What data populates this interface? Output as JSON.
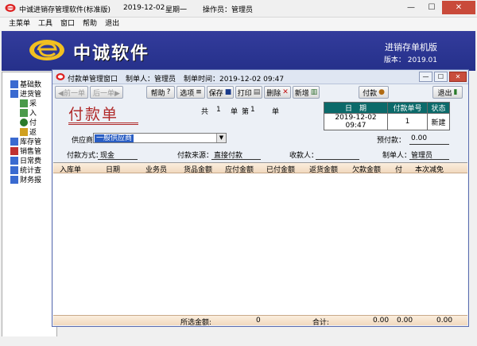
{
  "window": {
    "title": "中诚进销存管理软件(标准版)",
    "date": "2019-12-02",
    "weekday": "星期一",
    "operator": "操作员：管理员",
    "min": "—",
    "max": "☐",
    "close": "✕"
  },
  "menu": [
    "主菜单",
    "工具",
    "窗口",
    "帮助",
    "退出"
  ],
  "banner": {
    "brand": "中诚软件",
    "edition": "进销存单机版",
    "version": "版本：  2019.01"
  },
  "nav": [
    {
      "label": "基础数",
      "icon": "book-icon",
      "color": "#3a6ad0"
    },
    {
      "label": "进货管",
      "icon": "cart-icon",
      "color": "#3a6ad0"
    },
    {
      "label": "采",
      "icon": "doc-icon",
      "color": "#4a9a4a"
    },
    {
      "label": "入",
      "icon": "doc-icon",
      "color": "#4a9a4a"
    },
    {
      "label": "付",
      "icon": "coin-icon",
      "color": "#2a7a2a"
    },
    {
      "label": "返",
      "icon": "folder-icon",
      "color": "#d0a020"
    },
    {
      "label": "库存管",
      "icon": "warehouse-icon",
      "color": "#3a6ad0"
    },
    {
      "label": "销售管",
      "icon": "sales-icon",
      "color": "#c03030"
    },
    {
      "label": "日常费",
      "icon": "calendar-icon",
      "color": "#3a6ad0"
    },
    {
      "label": "统计查",
      "icon": "stats-icon",
      "color": "#3a6ad0"
    },
    {
      "label": "财务报",
      "icon": "finance-icon",
      "color": "#3a6ad0"
    }
  ],
  "child": {
    "title": "付款单管理窗口",
    "maker": "制单人：管理员",
    "make_time": "制单时间：2019-12-02 09:47"
  },
  "toolbar": {
    "prev": "◀前一单",
    "next": "后一单▶",
    "help": "帮助",
    "options": "选项",
    "save": "保存",
    "print": "打印",
    "delete": "删除",
    "add": "新增",
    "pay": "付款",
    "exit": "退出"
  },
  "form": {
    "title": "付款单",
    "total_label": "共",
    "total_num": "1",
    "unit_label": "单",
    "nth_label": "第",
    "nth_num": "1",
    "nth_unit": "单",
    "supplier_label": "供应商：",
    "supplier_value": "一般供应商",
    "prepay_label": "预付款：",
    "prepay_value": "0.00",
    "pay_method_label": "付款方式：",
    "pay_method_value": "现金",
    "pay_source_label": "付款来源：",
    "pay_source_value": "直接付款",
    "payee_label": "收款人：",
    "payee_value": "",
    "maker_label": "制单人：",
    "maker_value": "管理员"
  },
  "info": {
    "headers": [
      "日　期",
      "付款单号",
      "状态"
    ],
    "values": [
      "2019-12-02 09:47",
      "1",
      "新建"
    ]
  },
  "grid": {
    "columns": [
      "入库单",
      "日期",
      "业务员",
      "货品金额",
      "应付金额",
      "已付金额",
      "返货金额",
      "欠款金额",
      "付",
      "本次减免"
    ],
    "rows": []
  },
  "footer": {
    "selected_label": "所选金额:",
    "selected_value": "0",
    "total_label": "合计:",
    "total_a": "0.00",
    "total_b": "0.00",
    "total_c": "0.00"
  },
  "colors": {
    "banner": "#2d3896",
    "form_title": "#b02a2a",
    "info_header": "#0b6a6a",
    "selection": "#2a5ec4"
  }
}
